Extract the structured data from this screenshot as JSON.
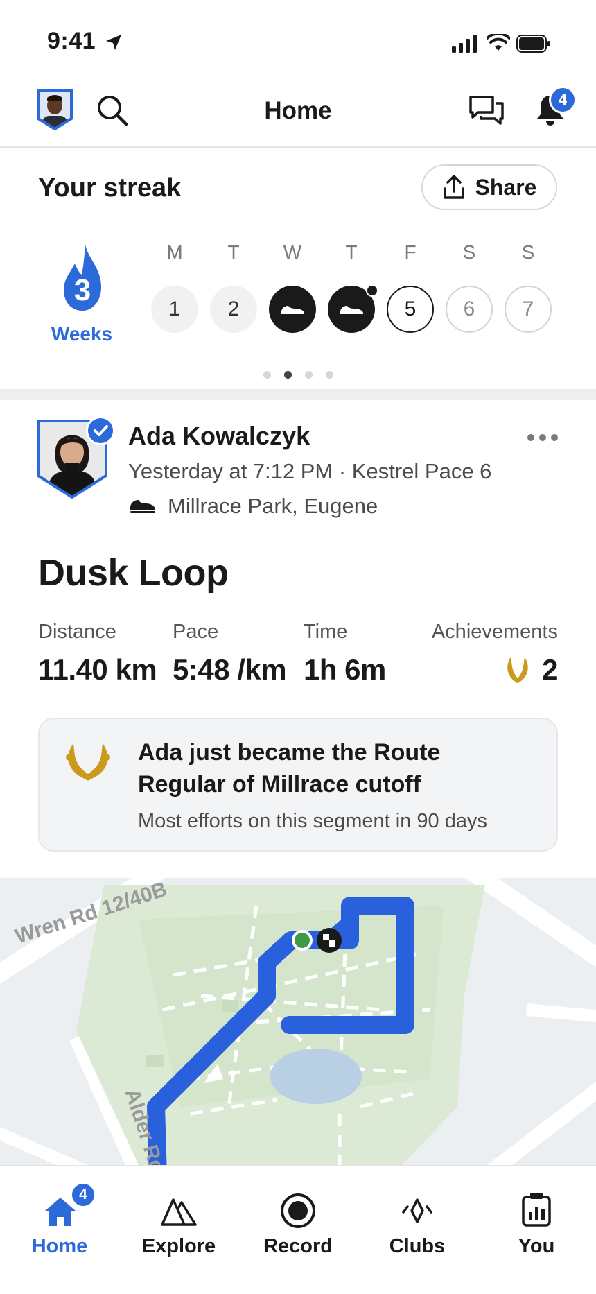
{
  "status_bar": {
    "time": "9:41"
  },
  "header": {
    "title": "Home",
    "notification_count": "4"
  },
  "streak": {
    "title": "Your streak",
    "share_label": "Share",
    "count": "3",
    "unit": "Weeks",
    "days": [
      {
        "letter": "M",
        "value": "1",
        "state": "empty"
      },
      {
        "letter": "T",
        "value": "2",
        "state": "empty"
      },
      {
        "letter": "W",
        "value": "",
        "state": "done"
      },
      {
        "letter": "T",
        "value": "",
        "state": "done"
      },
      {
        "letter": "F",
        "value": "5",
        "state": "today"
      },
      {
        "letter": "S",
        "value": "6",
        "state": "future"
      },
      {
        "letter": "S",
        "value": "7",
        "state": "future"
      }
    ],
    "page_count": 4,
    "active_page": 2
  },
  "activity": {
    "athlete_name": "Ada Kowalczyk",
    "meta": "Yesterday at 7:12 PM · Kestrel Pace 6",
    "location": "Millrace Park, Eugene",
    "title": "Dusk Loop",
    "stats": {
      "distance_label": "Distance",
      "distance_value": "11.40 km",
      "pace_label": "Pace",
      "pace_value": "5:48 /km",
      "time_label": "Time",
      "time_value": "1h 6m",
      "achievements_label": "Achievements",
      "achievements_value": "2"
    },
    "achievement": {
      "headline": "Ada just became the Route Regular of Millrace cutoff",
      "subtext": "Most efforts on this segment in 90 days"
    },
    "map": {
      "road_1": "Wren Rd 12/40B",
      "road_2": "Alder Rd"
    }
  },
  "tabs": [
    {
      "label": "Home",
      "active": true,
      "badge": "4"
    },
    {
      "label": "Explore",
      "active": false
    },
    {
      "label": "Record",
      "active": false
    },
    {
      "label": "Clubs",
      "active": false
    },
    {
      "label": "You",
      "active": false
    }
  ],
  "colors": {
    "accent": "#2d6ad9",
    "gold": "#c99a1c",
    "map_park": "#d9e8d2",
    "route": "#2960db"
  }
}
